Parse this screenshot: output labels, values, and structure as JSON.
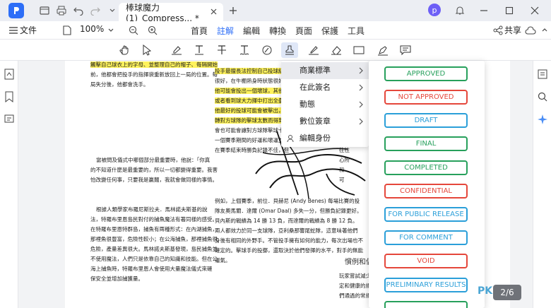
{
  "titlebar": {
    "tab_title": "棒球魔力 (1)_Compress... *",
    "avatar_letter": "p"
  },
  "menubar": {
    "file_label": "文件",
    "zoom": "100%",
    "tabs": [
      "首頁",
      "註解",
      "編輯",
      "轉換",
      "頁面",
      "保護",
      "工具"
    ],
    "active_tab": "註解",
    "share_label": "共享"
  },
  "submenu": {
    "items": [
      {
        "label": "商業標準",
        "has_arrow": true
      },
      {
        "label": "在此簽名",
        "has_arrow": true
      },
      {
        "label": "動態",
        "has_arrow": true
      },
      {
        "label": "數位簽章",
        "has_arrow": true
      },
      {
        "label": "編輯身份",
        "has_arrow": false
      }
    ]
  },
  "stamps": [
    {
      "label": "APPROVED",
      "color": "#27a05c"
    },
    {
      "label": "NOT APPROVED",
      "color": "#e5473b"
    },
    {
      "label": "DRAFT",
      "color": "#2b9fd9"
    },
    {
      "label": "FINAL",
      "color": "#27a05c"
    },
    {
      "label": "COMPLETED",
      "color": "#27a05c"
    },
    {
      "label": "CONFIDENTIAL",
      "color": "#e5473b"
    },
    {
      "label": "FOR PUBLIC RELEASE",
      "color": "#2b9fd9"
    },
    {
      "label": "FOR COMMENT",
      "color": "#2b9fd9"
    },
    {
      "label": "VOID",
      "color": "#e5473b"
    },
    {
      "label": "PRELIMINARY RESULTS",
      "color": "#2b9fd9"
    }
  ],
  "document": {
    "left_col": {
      "p1_hl": "觸擊自己球衣上的字母、並整理自己的帽子、每隔開始",
      "p1_a": "前，他都會把投手的指揮袋重新放回上一局的位置。每",
      "p1_b": "局失分後，他都會洗手。",
      "p2_a": "當被問及儀式中哪個部分最重要時，他說：「你真",
      "p2_b": "的不知道什麼是最重要的，所以一切都變得重要。我害",
      "p2_c": "怕改變任何事，只要我是贏麵，我就會做同樣的事情。",
      "p3_a": "根據人類學家布羅尼斯拉夫．馬林諾夫斯基的說",
      "p3_b": "法，特羅布里恩島民對付的捕魚魔法有著同樣的感受。",
      "p3_c": "在特羅布里恩特群島，捕魚有兩種形式：在內湖捕魚，",
      "p3_d": "那裡魚很豐富，危險性較小；在公海捕魚，那裡捕魚很",
      "p3_e": "危險，產量差異很大。馬林諾夫斯基發現，島民捕魚並",
      "p3_f": "不使用魔法，人們只是依靠自己的知識和技能。但在公",
      "p3_g": "海上捕魚時，特羅布里恩人會使用大量魔法儀式來確",
      "p3_h": "保安全並增加捕獲量。"
    },
    "right_col": {
      "p1_hl": "投手最擅長法控制自己投球結果",
      "p1_b": "很好，在牛棚熱身時狀態很好，也",
      "p1_c_hl": "他可能會投出一個壞球，其他球員",
      "p1_d_hl": "或者看到球大力揮中打出全壘打",
      "p1_e_hl": "他最好的投球可能會被擊出，而最",
      "p1_f_hl": "轉對方球隊的擊球太數而得到雙殺",
      "p1_g": "會也可能會讓對方球隊擊球十分",
      "p1_h": "一個賽季期間的好運和壞運並不",
      "p1_i": "在賽季結束時勝負記錄不佳，但",
      "p2_a": "例如，上個賽季，前位．貝赫尼 (Andy Benes) 每場比賽的投",
      "p2_b": "隊友奧馬爾．達爾 (Omar Daal) 多失一分，但勝負記錄更好。",
      "p2_c": "貝內斯的戰績為 14 勝 13 負，而達爾的戰績為 8 勝 12 負。",
      "p2_d": "兩人都效力於同一支球隊，亞利桑那響尾蛇隊，這意味著他們",
      "p2_e": "身後有相同的外野手。不管投手擁有如何的能力，每次出場也不",
      "p2_f": "確定的。擊球手的投擲，還取決於他們發揮的水平，對手的無能",
      "p2_g": "運氣。",
      "heading": "慣例和偶",
      "p3_a": "玩家嘗試減少",
      "p3_b": "定和健康的規",
      "p3_c": "們通過的常規",
      "side_a": "往往",
      "side_b": "心所",
      "side_c": "和",
      "side_d": "可"
    }
  },
  "page_indicator": "2/6",
  "watermark": "PK"
}
